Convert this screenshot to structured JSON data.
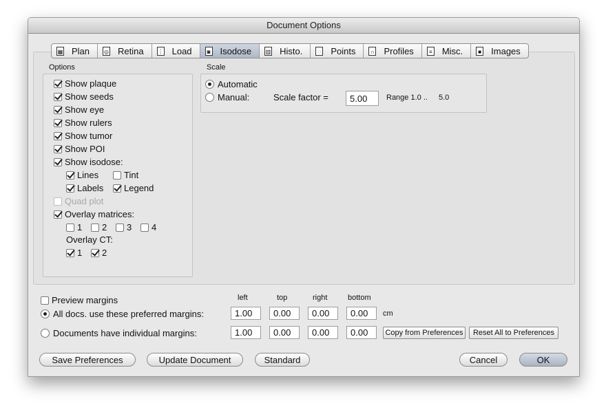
{
  "window": {
    "title": "Document Options"
  },
  "tabs": [
    {
      "label": "Plan",
      "icon": "plan-doc-icon"
    },
    {
      "label": "Retina",
      "icon": "retina-doc-icon"
    },
    {
      "label": "Load",
      "icon": "load-doc-icon"
    },
    {
      "label": "Isodose",
      "icon": "isodose-doc-icon",
      "selected": true
    },
    {
      "label": "Histo.",
      "icon": "histo-doc-icon"
    },
    {
      "label": "Points",
      "icon": "points-doc-icon"
    },
    {
      "label": "Profiles",
      "icon": "profiles-doc-icon"
    },
    {
      "label": "Misc.",
      "icon": "misc-doc-icon"
    },
    {
      "label": "Images",
      "icon": "images-doc-icon"
    }
  ],
  "options": {
    "title": "Options",
    "show_plaque": {
      "label": "Show plaque",
      "checked": true
    },
    "show_seeds": {
      "label": "Show seeds",
      "checked": true
    },
    "show_eye": {
      "label": "Show eye",
      "checked": true
    },
    "show_rulers": {
      "label": "Show rulers",
      "checked": true
    },
    "show_tumor": {
      "label": "Show tumor",
      "checked": true
    },
    "show_poi": {
      "label": "Show POI",
      "checked": true
    },
    "show_isodose": {
      "label": "Show isodose:",
      "checked": true
    },
    "lines": {
      "label": "Lines",
      "checked": true
    },
    "tint": {
      "label": "Tint",
      "checked": false
    },
    "labels": {
      "label": "Labels",
      "checked": true
    },
    "legend": {
      "label": "Legend",
      "checked": true
    },
    "quad_plot": {
      "label": "Quad plot",
      "checked": false,
      "disabled": true
    },
    "overlay_matrices": {
      "label": "Overlay matrices:",
      "checked": true
    },
    "matrix_1": {
      "label": "1",
      "checked": false
    },
    "matrix_2": {
      "label": "2",
      "checked": false
    },
    "matrix_3": {
      "label": "3",
      "checked": false
    },
    "matrix_4": {
      "label": "4",
      "checked": false
    },
    "overlay_ct_label": "Overlay CT:",
    "ct_1": {
      "label": "1",
      "checked": true
    },
    "ct_2": {
      "label": "2",
      "checked": true
    }
  },
  "scale": {
    "title": "Scale",
    "automatic_label": "Automatic",
    "manual_label": "Manual:",
    "selected": "automatic",
    "factor_label": "Scale factor =",
    "factor_value": "5.00",
    "range_label": "Range 1.0 ..",
    "range_max": "5.0"
  },
  "margins": {
    "preview_label": "Preview margins",
    "preview_checked": false,
    "headers": {
      "left": "left",
      "top": "top",
      "right": "right",
      "bottom": "bottom"
    },
    "all_docs_label": "All docs. use these preferred margins:",
    "individual_label": "Documents have individual margins:",
    "selected": "all",
    "preferred": {
      "left": "1.00",
      "top": "0.00",
      "right": "0.00",
      "bottom": "0.00"
    },
    "individual": {
      "left": "1.00",
      "top": "0.00",
      "right": "0.00",
      "bottom": "0.00"
    },
    "unit": "cm",
    "copy_label": "Copy from Preferences",
    "reset_label": "Reset All to Preferences"
  },
  "buttons": {
    "save": "Save Preferences",
    "update": "Update Document",
    "standard": "Standard",
    "cancel": "Cancel",
    "ok": "OK"
  }
}
